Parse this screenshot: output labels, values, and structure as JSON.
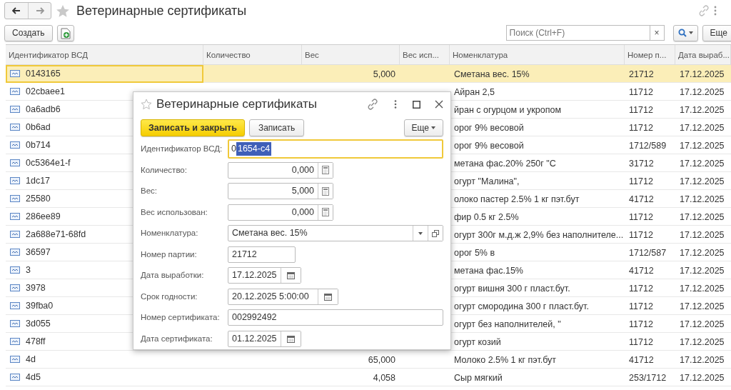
{
  "window": {
    "title": "Ветеринарные сертификаты"
  },
  "toolbar": {
    "create_button": "Создать",
    "search": {
      "placeholder": "Поиск (Ctrl+F)",
      "clear": "×"
    },
    "more_button": "Еще"
  },
  "table": {
    "columns": [
      "Идентификатор ВСД",
      "Количество",
      "Вес",
      "Вес исп...",
      "Номенклатура",
      "Номер п...",
      "Дата выраб..."
    ],
    "rows": [
      {
        "id": "0143165",
        "weight": "5,000",
        "nomenclature": "Сметана вес. 15%",
        "batch": "21712",
        "date": "17.12.2025",
        "selected": true
      },
      {
        "id": "02cbaee1",
        "nomenclature": "Айран 2,5",
        "batch": "11712",
        "date": "17.12.2025",
        "selected": false
      },
      {
        "id": "0a6adb6",
        "nomenclature": "йран с огурцом и укропом",
        "batch": "11712",
        "date": "17.12.2025",
        "selected": false
      },
      {
        "id": "0b6ad",
        "nomenclature": "орог 9% весовой",
        "batch": "11712",
        "date": "17.12.2025",
        "selected": false
      },
      {
        "id": "0b714",
        "nomenclature": "орог 9% весовой",
        "batch": "1712/589",
        "date": "17.12.2025",
        "selected": false
      },
      {
        "id": "0c5364e1-f",
        "nomenclature": "метана фас.20%  250г \"С",
        "batch": "31712",
        "date": "17.12.2025",
        "selected": false
      },
      {
        "id": "1dc17",
        "nomenclature": "огурт  \"Малина\",",
        "batch": "11712",
        "date": "17.12.2025",
        "selected": false
      },
      {
        "id": "25580",
        "nomenclature": "олоко пастер 2.5% 1 кг пэт.бут",
        "batch": "41712",
        "date": "17.12.2025",
        "selected": false
      },
      {
        "id": "286ee89",
        "nomenclature": "фир  0.5 кг 2.5%",
        "batch": "11712",
        "date": "17.12.2025",
        "selected": false
      },
      {
        "id": "2a688e71-68fd",
        "nomenclature": "огурт 300г  м.д.ж 2,9% без наполнителе...",
        "batch": "11712",
        "date": "17.12.2025",
        "selected": false
      },
      {
        "id": "36597",
        "nomenclature": "орог 5% в",
        "batch": "1712/587",
        "date": "17.12.2025",
        "selected": false
      },
      {
        "id": "3",
        "nomenclature": "метана фас.15%",
        "batch": "41712",
        "date": "17.12.2025",
        "selected": false
      },
      {
        "id": "3978",
        "nomenclature": "огурт вишня 300 г пласт.бут.",
        "batch": "11712",
        "date": "17.12.2025",
        "selected": false
      },
      {
        "id": "39fba0",
        "nomenclature": "огурт смородина 300 г пласт.бут.",
        "batch": "11712",
        "date": "17.12.2025",
        "selected": false
      },
      {
        "id": "3d055",
        "nomenclature": "огурт  без наполнителей, \"",
        "batch": "11712",
        "date": "17.12.2025",
        "selected": false
      },
      {
        "id": "478ff",
        "nomenclature": "огурт козий",
        "batch": "11712",
        "date": "17.12.2025",
        "selected": false
      },
      {
        "id": "4d",
        "weight": "65,000",
        "nomenclature": "Молоко 2.5% 1 кг пэт.бут",
        "batch": "41712",
        "date": "17.12.2025",
        "selected": false
      },
      {
        "id": "4d5",
        "weight": "4,058",
        "nomenclature": "Сыр мягкий",
        "batch": "253/1712",
        "date": "17.12.2025",
        "selected": false
      }
    ]
  },
  "dialog": {
    "title": "Ветеринарные сертификаты",
    "buttons": {
      "save_close": "Записать и закрыть",
      "save": "Записать",
      "more": "Еще"
    },
    "fields": [
      {
        "kind": "id",
        "label": "Идентификатор ВСД:",
        "value": "0",
        "value_selected": "1654-c4",
        "focused": true
      },
      {
        "kind": "number",
        "label": "Количество:",
        "value": "0,000",
        "focused": false
      },
      {
        "kind": "number",
        "label": "Вес:",
        "value": "5,000",
        "focused": false
      },
      {
        "kind": "number",
        "label": "Вес использован:",
        "value": "0,000",
        "focused": false
      },
      {
        "kind": "select",
        "label": "Номенклатура:",
        "value": "Сметана вес. 15%",
        "focused": false
      },
      {
        "kind": "short",
        "label": "Номер партии:",
        "value": "21712",
        "focused": false
      },
      {
        "kind": "date",
        "label": "Дата выработки:",
        "value": "17.12.2025",
        "focused": false
      },
      {
        "kind": "datetime",
        "label": "Срок годности:",
        "value": "20.12.2025  5:00:00",
        "focused": false
      },
      {
        "kind": "text",
        "label": "Номер сертификата:",
        "value": "002992492",
        "focused": false
      },
      {
        "kind": "date",
        "label": "Дата сертификата:",
        "value": "01.12.2025",
        "focused": false
      }
    ]
  }
}
